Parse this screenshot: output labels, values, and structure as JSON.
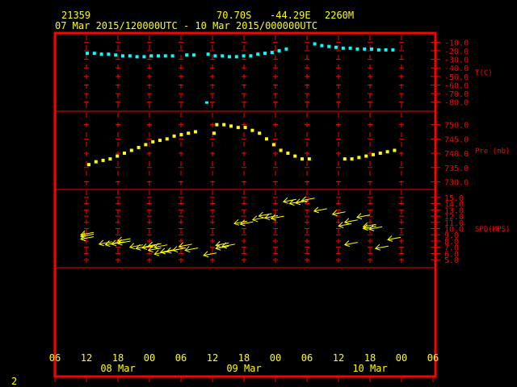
{
  "header": {
    "station": "21359",
    "lat": "70.70S",
    "lon": "-44.29E",
    "elev": "2260M",
    "period": "07 Mar 2015/120000UTC - 10 Mar 2015/000000UTC"
  },
  "footer": {
    "page_number": "2"
  },
  "colors": {
    "frame": "#ff0000",
    "text": "#ffff00",
    "temp": "#00ffff",
    "pres": "#ffff00",
    "wind": "#ffff00"
  },
  "chart_data": [
    {
      "type": "scatter",
      "panel": "temperature",
      "ylabel": "T(C)",
      "ylim": [
        -85,
        -5
      ],
      "y_ticks": [
        "-10.0",
        "-20.0",
        "-30.0",
        "-40.0",
        "-50.0",
        "-60.0",
        "-70.0",
        "-80.0"
      ],
      "x": [
        12,
        13,
        14,
        15,
        16,
        17,
        18,
        19,
        20,
        21,
        22,
        23,
        24,
        25,
        26,
        27,
        28,
        29,
        30,
        31,
        32,
        33,
        34,
        35,
        36,
        37,
        38,
        39,
        40,
        41,
        42,
        43,
        44,
        45,
        46,
        47,
        48,
        49,
        50,
        51,
        52,
        53,
        54,
        55
      ],
      "values": [
        -23,
        -23,
        -24,
        -24,
        -25,
        -26,
        -26,
        -27,
        -27,
        -26,
        -26,
        -26,
        -26,
        null,
        -25,
        -25,
        null,
        -24,
        -26,
        -26,
        -27,
        -27,
        -26,
        -26,
        -24,
        -23,
        -22,
        -20,
        -18,
        null,
        null,
        null,
        -12,
        -14,
        -15,
        -16,
        -17,
        -17,
        -18,
        -18,
        -18,
        -19,
        -19,
        -19
      ],
      "outliers": [
        {
          "x": 24,
          "y": -80
        }
      ]
    },
    {
      "type": "scatter",
      "panel": "pressure",
      "ylabel": "Pre (mb)",
      "ylim": [
        729,
        753
      ],
      "y_ticks": [
        "750.0",
        "745.0",
        "740.0",
        "735.0",
        "730.0"
      ],
      "x": [
        12,
        13,
        14,
        15,
        16,
        17,
        18,
        19,
        20,
        21,
        22,
        23,
        24,
        25,
        26,
        27,
        28,
        29,
        30,
        31,
        32,
        33,
        34,
        35,
        36,
        37,
        38,
        39,
        40,
        41,
        42,
        43,
        44,
        45,
        46,
        47,
        48,
        49,
        50,
        51,
        52,
        53,
        54,
        55
      ],
      "values": [
        736,
        737,
        737.5,
        738,
        739,
        740,
        741,
        742,
        743,
        744,
        744.5,
        745,
        746,
        746.5,
        747,
        747.5,
        null,
        null,
        750,
        750,
        749.5,
        749,
        749,
        748,
        747,
        745,
        743,
        741,
        740,
        739,
        738,
        738,
        null,
        null,
        null,
        null,
        738,
        738,
        738.5,
        739,
        739.5,
        740,
        740.5,
        741
      ],
      "extra_points": [
        {
          "x": 30,
          "y": 747
        }
      ]
    },
    {
      "type": "scatter",
      "panel": "wind",
      "ylabel": "SPD(MPS)",
      "ylim": [
        4.5,
        15.5
      ],
      "y_ticks": [
        "15.0",
        "14.0",
        "13.0",
        "12.0",
        "11.0",
        "10.0",
        "9.0",
        "8.0",
        "7.0",
        "6.0",
        "5.0"
      ],
      "direction_unit": "arrow",
      "points": [
        {
          "x": 12,
          "spd": 9.0
        },
        {
          "x": 12,
          "spd": 8.7
        },
        {
          "x": 12,
          "spd": 8.3
        },
        {
          "x": 15,
          "spd": 7.5
        },
        {
          "x": 16,
          "spd": 7.4
        },
        {
          "x": 17,
          "spd": 7.5
        },
        {
          "x": 18,
          "spd": 8.0
        },
        {
          "x": 18,
          "spd": 7.6
        },
        {
          "x": 20,
          "spd": 7.0
        },
        {
          "x": 21,
          "spd": 6.8
        },
        {
          "x": 22,
          "spd": 6.9
        },
        {
          "x": 23,
          "spd": 7.2
        },
        {
          "x": 23,
          "spd": 6.5
        },
        {
          "x": 24,
          "spd": 7.0
        },
        {
          "x": 24,
          "spd": 5.9
        },
        {
          "x": 25,
          "spd": 6.2
        },
        {
          "x": 26,
          "spd": 6.3
        },
        {
          "x": 27,
          "spd": 6.5
        },
        {
          "x": 28,
          "spd": 7.1
        },
        {
          "x": 29,
          "spd": 6.5
        },
        {
          "x": 32,
          "spd": 5.7
        },
        {
          "x": 34,
          "spd": 6.8
        },
        {
          "x": 34,
          "spd": 7.3
        },
        {
          "x": 35,
          "spd": 7.1
        },
        {
          "x": 37,
          "spd": 10.8
        },
        {
          "x": 38,
          "spd": 10.7
        },
        {
          "x": 40,
          "spd": 11.4
        },
        {
          "x": 41,
          "spd": 12.0
        },
        {
          "x": 42,
          "spd": 11.7
        },
        {
          "x": 43,
          "spd": 11.6
        },
        {
          "x": 45,
          "spd": 14.3
        },
        {
          "x": 46,
          "spd": 14.0
        },
        {
          "x": 47,
          "spd": 14.1
        },
        {
          "x": 48,
          "spd": 14.5
        },
        {
          "x": 50,
          "spd": 12.8
        },
        {
          "x": 53,
          "spd": 12.3
        },
        {
          "x": 54,
          "spd": 10.4
        },
        {
          "x": 55,
          "spd": 11.0
        },
        {
          "x": 55,
          "spd": 7.4
        },
        {
          "x": 57,
          "spd": 11.8
        },
        {
          "x": 58,
          "spd": 10.3
        },
        {
          "x": 58,
          "spd": 10.0
        },
        {
          "x": 59,
          "spd": 9.9
        },
        {
          "x": 60,
          "spd": 6.8
        },
        {
          "x": 62,
          "spd": 8.2
        }
      ]
    }
  ],
  "x_axis": {
    "hour_ticks": [
      6,
      12,
      18,
      0,
      6,
      12,
      18,
      0,
      6,
      12,
      18,
      0,
      6
    ],
    "hour_labels": [
      "06",
      "12",
      "18",
      "00",
      "06",
      "12",
      "18",
      "00",
      "06",
      "12",
      "18",
      "00",
      "06"
    ],
    "day_labels": [
      "08 Mar",
      "09 Mar",
      "10 Mar"
    ],
    "day_label_hours": [
      18,
      42,
      66
    ]
  }
}
